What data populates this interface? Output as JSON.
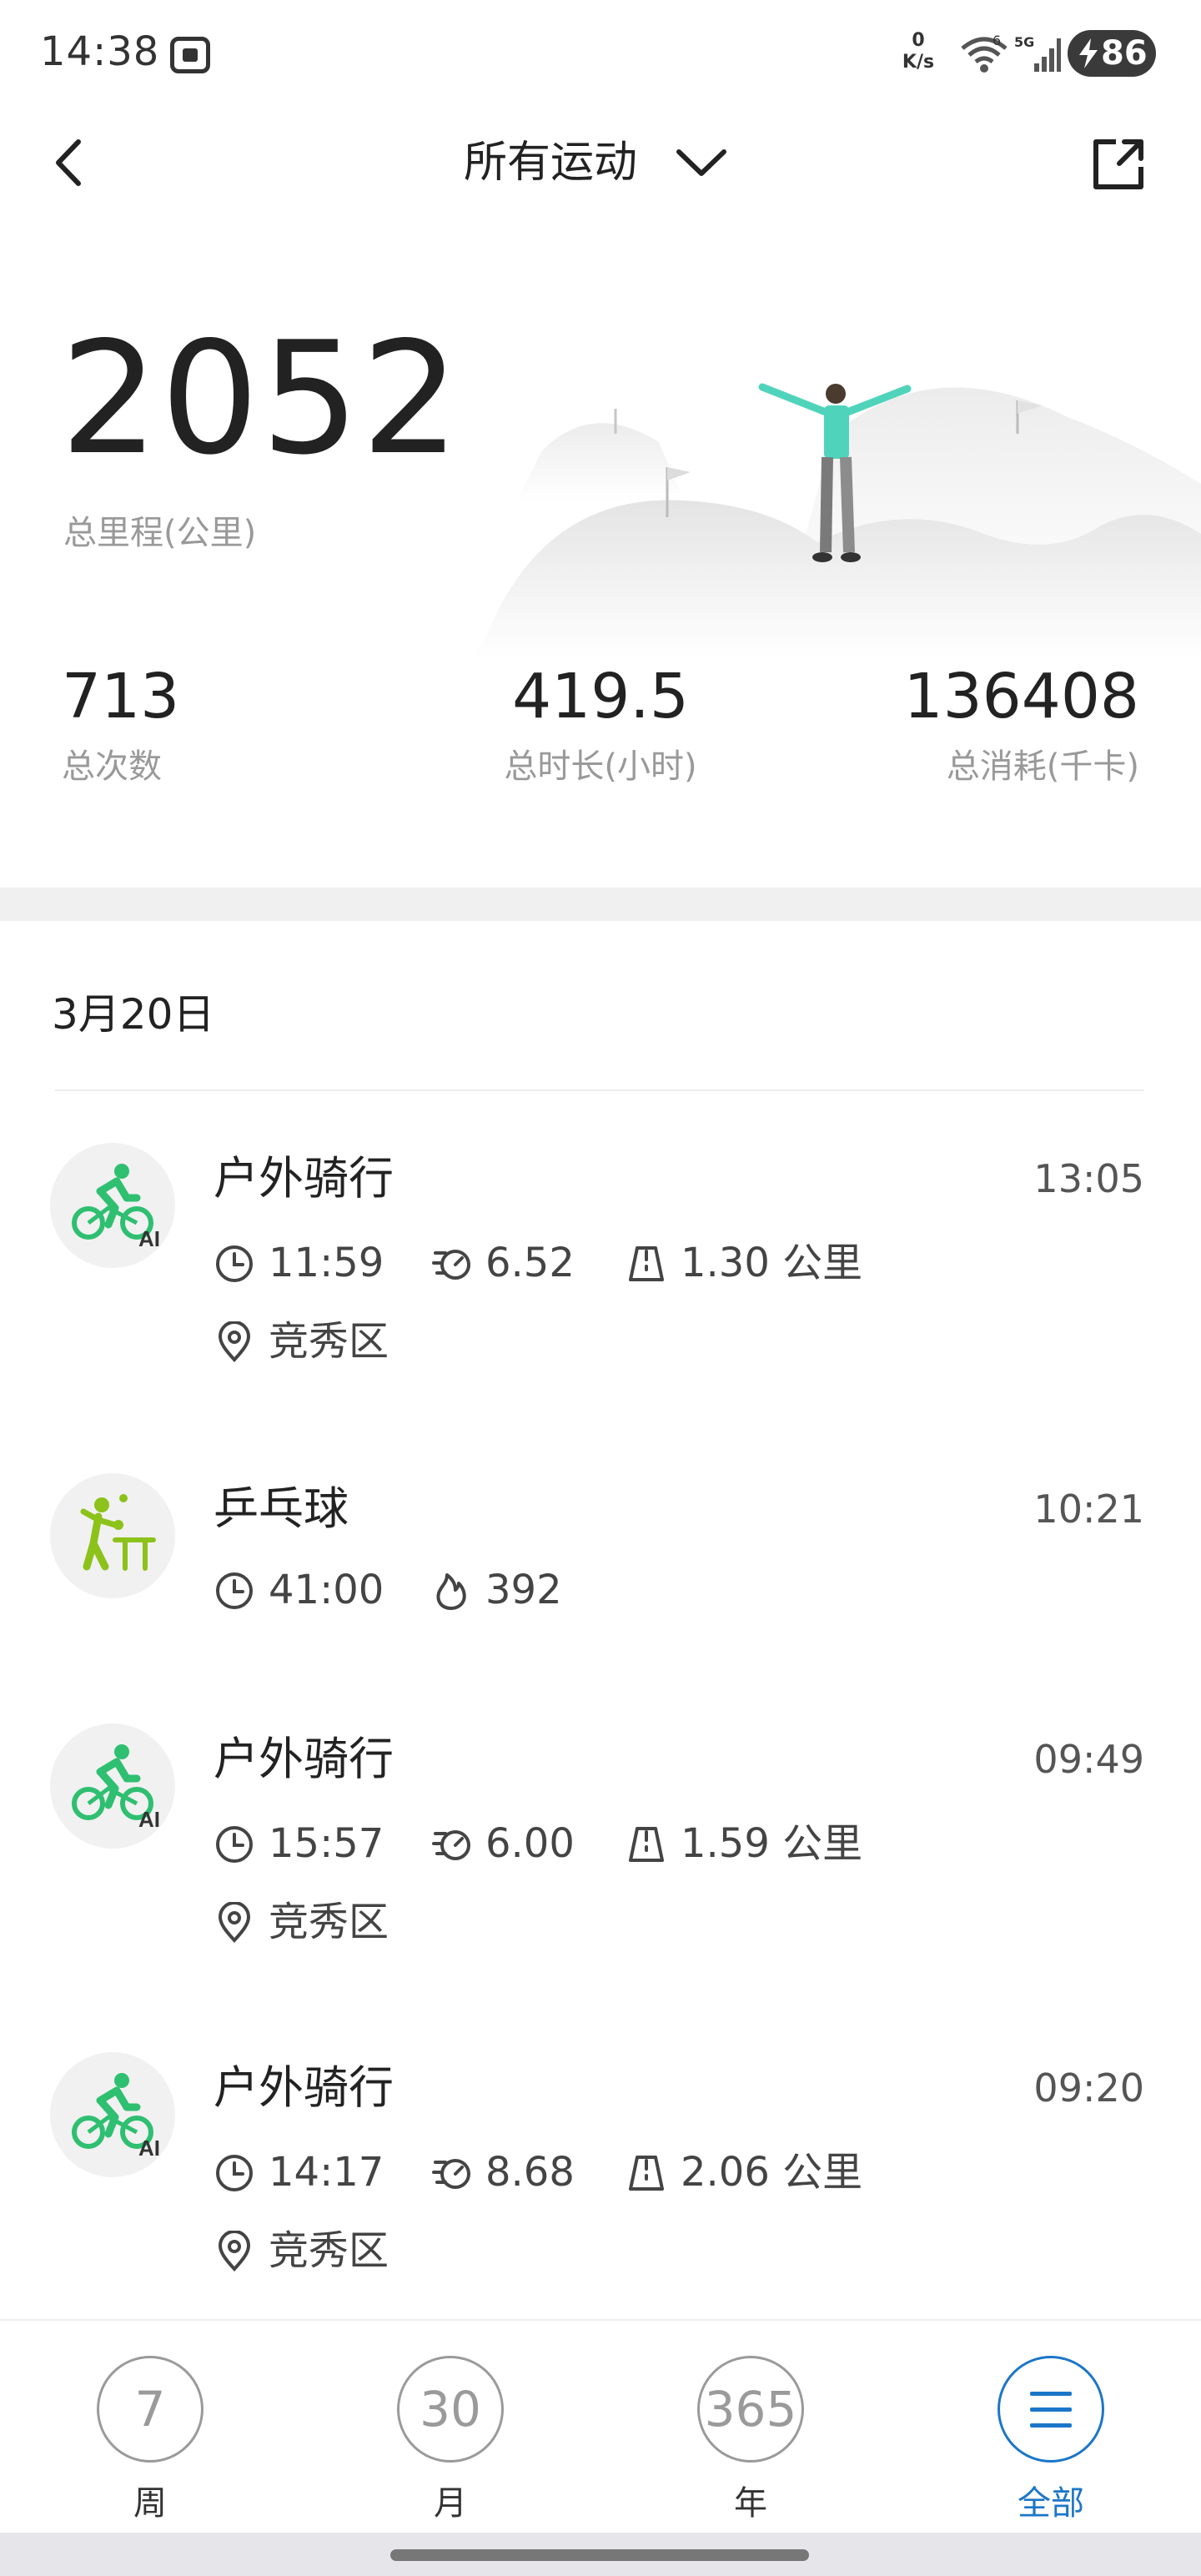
{
  "status_bar": {
    "time": "14:38",
    "net_speed_value": "0",
    "net_speed_unit": "K/s",
    "wifi_label": "6",
    "cell_label": "5G",
    "battery": "86"
  },
  "header": {
    "title": "所有运动",
    "back_icon": "chevron-left-icon",
    "caret_icon": "chevron-down-icon",
    "share_icon": "share-export-icon"
  },
  "summary": {
    "total_distance": "2052",
    "total_distance_label": "总里程(公里)",
    "stats": [
      {
        "value": "713",
        "label": "总次数"
      },
      {
        "value": "419.5",
        "label": "总时长(小时)"
      },
      {
        "value": "136408",
        "label": "总消耗(千卡)"
      }
    ]
  },
  "date_header": "3月20日",
  "records": [
    {
      "type": "户外骑行",
      "icon": "cycling-icon",
      "badge": "AI",
      "time": "13:05",
      "duration": "11:59",
      "pace": "6.52",
      "distance": "1.30 公里",
      "location": "竞秀区"
    },
    {
      "type": "乒乓球",
      "icon": "table-tennis-icon",
      "time": "10:21",
      "duration": "41:00",
      "calories": "392"
    },
    {
      "type": "户外骑行",
      "icon": "cycling-icon",
      "badge": "AI",
      "time": "09:49",
      "duration": "15:57",
      "pace": "6.00",
      "distance": "1.59 公里",
      "location": "竞秀区"
    },
    {
      "type": "户外骑行",
      "icon": "cycling-icon",
      "badge": "AI",
      "time": "09:20",
      "duration": "14:17",
      "pace": "8.68",
      "distance": "2.06 公里",
      "location": "竞秀区"
    }
  ],
  "bottom_nav": {
    "items": [
      {
        "circle": "7",
        "label": "周"
      },
      {
        "circle": "30",
        "label": "月"
      },
      {
        "circle": "365",
        "label": "年"
      },
      {
        "circle": "",
        "label": "全部",
        "active": true
      }
    ]
  },
  "colors": {
    "accent_blue": "#1b76c9",
    "cycling_green": "#2fbf71",
    "table_tennis_green": "#8cc21a",
    "text_primary": "#222222",
    "text_secondary": "#999999"
  }
}
